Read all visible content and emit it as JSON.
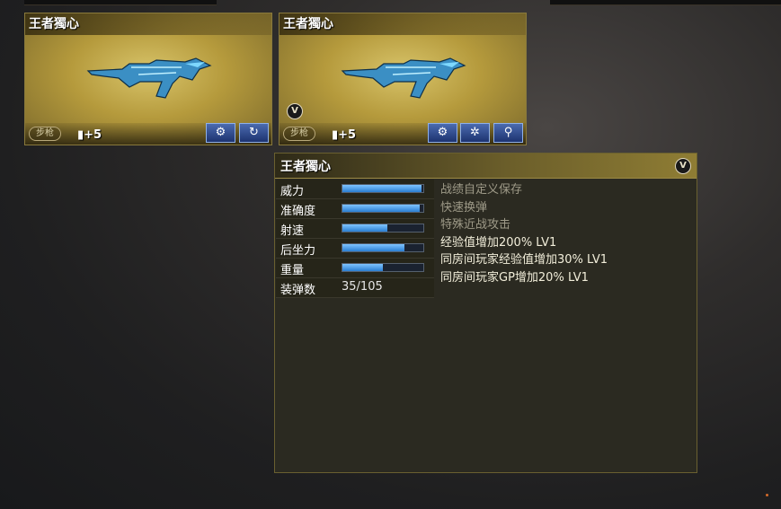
{
  "cards": [
    {
      "title": "王者獨心",
      "type_badge": "步枪",
      "level": "+5",
      "buttons": [
        "gear-wrench",
        "refresh"
      ]
    },
    {
      "title": "王者獨心",
      "type_badge": "步枪",
      "level": "+5",
      "vip_badge": "V",
      "buttons": [
        "gear-wrench",
        "gear",
        "magnifier"
      ]
    }
  ],
  "detail": {
    "title": "王者獨心",
    "vip_badge": "V",
    "stats": [
      {
        "label": "威力",
        "fill": 0.98
      },
      {
        "label": "准确度",
        "fill": 0.96
      },
      {
        "label": "射速",
        "fill": 0.55
      },
      {
        "label": "后坐力",
        "fill": 0.77
      },
      {
        "label": "重量",
        "fill": 0.5
      }
    ],
    "ammo": {
      "label": "装弹数",
      "value": "35/105"
    },
    "features": [
      {
        "text": "战绩自定义保存",
        "style": "dim"
      },
      {
        "text": "快速换弹",
        "style": "dim"
      },
      {
        "text": "特殊近战攻击",
        "style": "dim"
      },
      {
        "text": "经验值增加200% LV1",
        "style": "bright"
      },
      {
        "text": "同房间玩家经验值增加30% LV1",
        "style": "bright"
      },
      {
        "text": "同房间玩家GP增加20% LV1",
        "style": "bright"
      }
    ]
  },
  "colors": {
    "bar_fill": "#2a7fd2",
    "card_bg": "#b59a3c",
    "panel_bg": "#2b2a21"
  }
}
